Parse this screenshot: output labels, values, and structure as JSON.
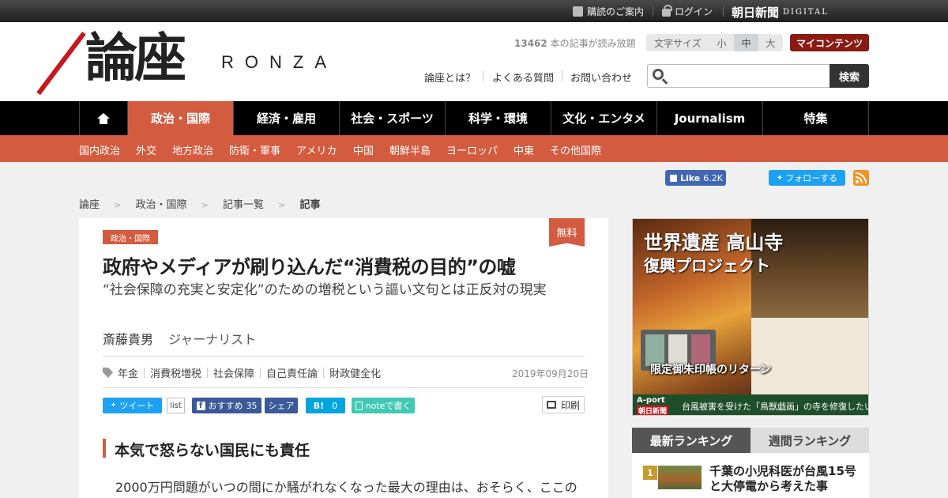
{
  "topbar": {
    "subscribe_label": "購読のご案内",
    "login_label": "ログイン",
    "asahi_logo": "朝日新聞",
    "digital_logo": "DIGITAL"
  },
  "header": {
    "logo_kanji": "論座",
    "logo_roman": "RONZA",
    "article_count": "13462",
    "article_count_suffix": "本の記事が読み放題",
    "font_size_label": "文字サイズ",
    "font_size_options": [
      "小",
      "中",
      "大"
    ],
    "font_size_selected": "中",
    "my_contents_label": "マイコンテンツ",
    "links": [
      "論座とは？",
      "よくある質問",
      "お問い合わせ"
    ],
    "search_placeholder": "",
    "search_button": "検索"
  },
  "nav": {
    "items": [
      "政治・国際",
      "経済・雇用",
      "社会・スポーツ",
      "科学・環境",
      "文化・エンタメ",
      "Journalism",
      "特集"
    ],
    "active": "政治・国際"
  },
  "subnav": {
    "items": [
      "国内政治",
      "外交",
      "地方政治",
      "防衛・軍事",
      "アメリカ",
      "中国",
      "朝鮮半島",
      "ヨーロッパ",
      "中東",
      "その他国際"
    ]
  },
  "social": {
    "fb_like_label": "Like",
    "fb_like_count": "6.2K",
    "tw_follow_label": "フォローする"
  },
  "breadcrumb": {
    "items": [
      "論座",
      "政治・国際",
      "記事一覧",
      "記事"
    ],
    "separator": ">"
  },
  "article": {
    "category_badge": "政治・国際",
    "free_badge": "無料",
    "title": "政府やメディアが刷り込んだ“消費税の目的”の嘘",
    "subtitle": "“社会保障の充実と安定化”のための増税という謳い文句とは正反対の現実",
    "author_name": "斎藤貴男",
    "author_role": "ジャーナリスト",
    "tags": [
      "年金",
      "消費税増税",
      "社会保障",
      "自己責任論",
      "財政健全化"
    ],
    "date": "2019年09月20日",
    "share": {
      "tweet_label": "ツイート",
      "list_label": "list",
      "fb_recommend_label": "おすすめ",
      "fb_recommend_count": "35",
      "fb_share_label": "シェア",
      "hatena_label": "B!",
      "hatena_count": "0",
      "note_label": "noteで書く",
      "print_label": "印刷"
    },
    "section_heading": "本気で怒らない国民にも責任",
    "body_first_line": "2000万円問題がいつの間にか騒がれなくなった最大の理由は、おそらく、ここの"
  },
  "ad": {
    "title_line1": "世界遺産 高山寺",
    "title_line2": "復興プロジェクト",
    "banner_text": "限定御朱印帳のリターン",
    "brand_top": "A-port",
    "brand_bottom": "朝日新聞",
    "footer_text": "台風被害を受けた「鳥獣戯画」の寺を修復したい"
  },
  "ranking": {
    "tabs": [
      "最新ランキング",
      "週間ランキング"
    ],
    "active_tab": "最新ランキング",
    "items": [
      {
        "rank": "1",
        "title": "千葉の小児科医が台風15号と大停電から考えた事"
      }
    ]
  },
  "colors": {
    "accent": "#d35b3f",
    "my_contents": "#8b1a12",
    "nav_bg": "#000000",
    "rank_badge": "#c69a2c"
  }
}
